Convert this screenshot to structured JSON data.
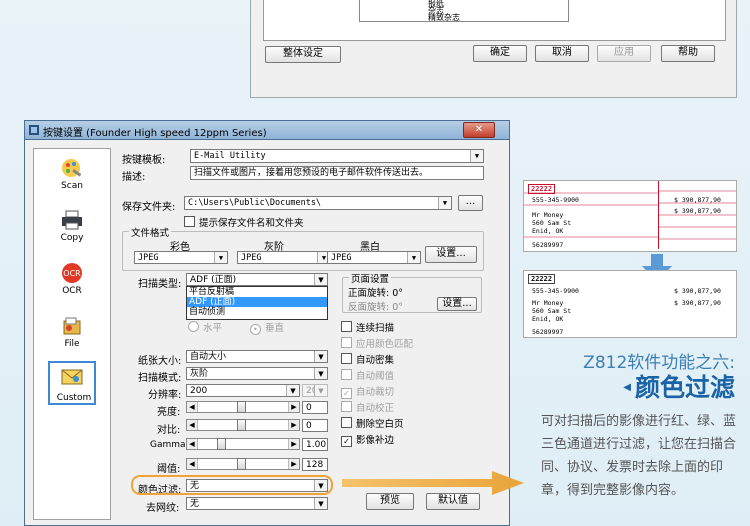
{
  "top_dialog": {
    "list_items": [
      "报纸",
      "杂志",
      "精致杂志"
    ],
    "buttons": {
      "global": "整体设定",
      "ok": "确定",
      "cancel": "取消",
      "apply": "应用",
      "help": "帮助"
    }
  },
  "dialog": {
    "title": "按键设置 (Founder High speed 12ppm Series)",
    "close": "✕",
    "sidebar": [
      {
        "label": "Scan",
        "icon": "scan-icon"
      },
      {
        "label": "Copy",
        "icon": "printer-icon"
      },
      {
        "label": "OCR",
        "icon": "ocr-icon"
      },
      {
        "label": "File",
        "icon": "file-icon"
      },
      {
        "label": "Custom",
        "icon": "custom-icon"
      }
    ],
    "template_label": "按键模板:",
    "template_value": "E-Mail Utility",
    "desc_label": "描述:",
    "desc_value": "扫描文件或图片，接着用您预设的电子邮件软件传送出去。",
    "save_label": "保存文件夹:",
    "save_value": "C:\\Users\\Public\\Documents\\",
    "browse": "...",
    "prompt_name": "提示保存文件名和文件夹",
    "format_group": "文件格式",
    "color_label": "彩色",
    "gray_label": "灰阶",
    "bw_label": "黑白",
    "color_value": "JPEG",
    "gray_value": "JPEG",
    "bw_value": "JPEG",
    "format_settings": "设置...",
    "scan_type_label": "扫描类型:",
    "scan_type_value": "ADF (正面)",
    "scan_type_options": [
      "平台反射稿",
      "ADF (正面)",
      "自动侦测"
    ],
    "orient_h": "水平",
    "orient_v": "垂直",
    "page_group": "页面设置",
    "front_rot": "正面旋转: 0°",
    "back_rot": "反面旋转: 0°",
    "page_settings": "设置...",
    "paper_label": "纸张大小:",
    "paper_value": "自动大小",
    "mode_label": "扫描模式:",
    "mode_value": "灰阶",
    "res_label": "分辨率:",
    "res_value": "200",
    "res_value2": "200",
    "bright_label": "亮度:",
    "bright_value": "0",
    "contrast_label": "对比:",
    "contrast_value": "0",
    "gamma_label": "Gamma:",
    "gamma_value": "1.00",
    "thresh_label": "阈值:",
    "thresh_value": "128",
    "colorfilter_label": "颜色过滤:",
    "colorfilter_value": "无",
    "descreen_label": "去网纹:",
    "descreen_value": "无",
    "preview": "预览",
    "defaults": "默认值",
    "checks": [
      {
        "label": "连续扫描",
        "checked": false,
        "disabled": false
      },
      {
        "label": "应用颜色匹配",
        "checked": false,
        "disabled": true
      },
      {
        "label": "自动密集",
        "checked": false,
        "disabled": false
      },
      {
        "label": "自动阈值",
        "checked": false,
        "disabled": true
      },
      {
        "label": "自动裁切",
        "checked": true,
        "disabled": true
      },
      {
        "label": "自动校正",
        "checked": false,
        "disabled": true
      },
      {
        "label": "删除空白页",
        "checked": false,
        "disabled": false
      },
      {
        "label": "影像补边",
        "checked": true,
        "disabled": false
      }
    ]
  },
  "doc_before": {
    "id": "22222",
    "phone": "555-345-9900",
    "amount1": "$ 390,877,90",
    "amount2": "$ 390,877,90",
    "name": "Mr Money",
    "street": "560 Sam St",
    "city": "Enid, OK",
    "ssn": "56289997"
  },
  "doc_after": {
    "id": "22222",
    "phone": "555-345-9900",
    "amount1": "$ 390,877,90",
    "amount2": "$ 390,877,90",
    "name": "Mr Money",
    "street": "560 Sam St",
    "city": "Enid, OK",
    "ssn": "56289997"
  },
  "feature": {
    "subtitle": "Z812软件功能之六:",
    "title": "颜色过滤",
    "description": "可对扫描后的影像进行红、绿、蓝三色通道进行过滤，让您在扫描合同、协议、发票时去除上面的印章，得到完整影像内容。"
  },
  "colors": {
    "accent": "#1a63a6",
    "highlight": "#f0a437",
    "red_form": "#c8102e"
  }
}
